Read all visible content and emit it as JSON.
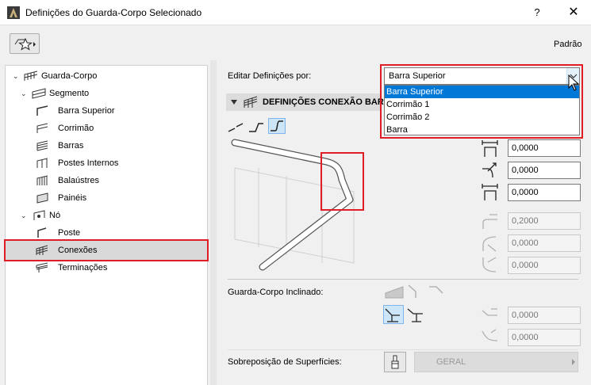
{
  "window": {
    "title": "Definições do Guarda-Corpo Selecionado",
    "help_label": "?",
    "close_label": "✕"
  },
  "header": {
    "preset_label": "Padrão"
  },
  "tree": {
    "items": [
      {
        "label": "Guarda-Corpo",
        "icon": "railing-icon",
        "expander": "⌄"
      },
      {
        "label": "Segmento",
        "icon": "segment-icon",
        "expander": "⌄"
      },
      {
        "label": "Barra Superior",
        "icon": "top-rail-icon"
      },
      {
        "label": "Corrimão",
        "icon": "handrail-icon"
      },
      {
        "label": "Barras",
        "icon": "rails-icon"
      },
      {
        "label": "Postes Internos",
        "icon": "inner-posts-icon"
      },
      {
        "label": "Balaústres",
        "icon": "balusters-icon"
      },
      {
        "label": "Painéis",
        "icon": "panels-icon"
      },
      {
        "label": "Nó",
        "icon": "node-icon",
        "expander": "⌄"
      },
      {
        "label": "Poste",
        "icon": "post-icon"
      },
      {
        "label": "Conexões",
        "icon": "connections-icon",
        "selected": true
      },
      {
        "label": "Terminações",
        "icon": "endings-icon"
      }
    ]
  },
  "edit_by": {
    "label": "Editar Definições por:",
    "selected": "Barra Superior",
    "options": [
      "Barra Superior",
      "Corrimão 1",
      "Corrimão 2",
      "Barra"
    ]
  },
  "section": {
    "title": "DEFINIÇÕES CONEXÃO BARRA"
  },
  "connection_fields": [
    {
      "value": "0,0000",
      "icon": "horizontal-offset-icon",
      "enabled": true
    },
    {
      "value": "0,0000",
      "icon": "radius-icon",
      "enabled": true
    },
    {
      "value": "0,0000",
      "icon": "vertical-offset-icon",
      "enabled": true
    },
    {
      "value": "0,2000",
      "icon": "extension-icon",
      "enabled": false
    },
    {
      "value": "0,0000",
      "icon": "bend-radius-icon",
      "enabled": false
    },
    {
      "value": "0,0000",
      "icon": "lower-bend-icon",
      "enabled": false
    }
  ],
  "inclined": {
    "label": "Guarda-Corpo Inclinado:",
    "fields": [
      {
        "value": "0,0000",
        "icon": "slope-offset-icon"
      },
      {
        "value": "0,0000",
        "icon": "slope-radius-icon"
      }
    ]
  },
  "surface": {
    "label": "Sobreposição de Superfícies:",
    "value": "GERAL"
  },
  "colors": {
    "highlight_red": "#e01c24",
    "list_selection": "#0078d7",
    "active_toggle": "#cde6f7"
  }
}
